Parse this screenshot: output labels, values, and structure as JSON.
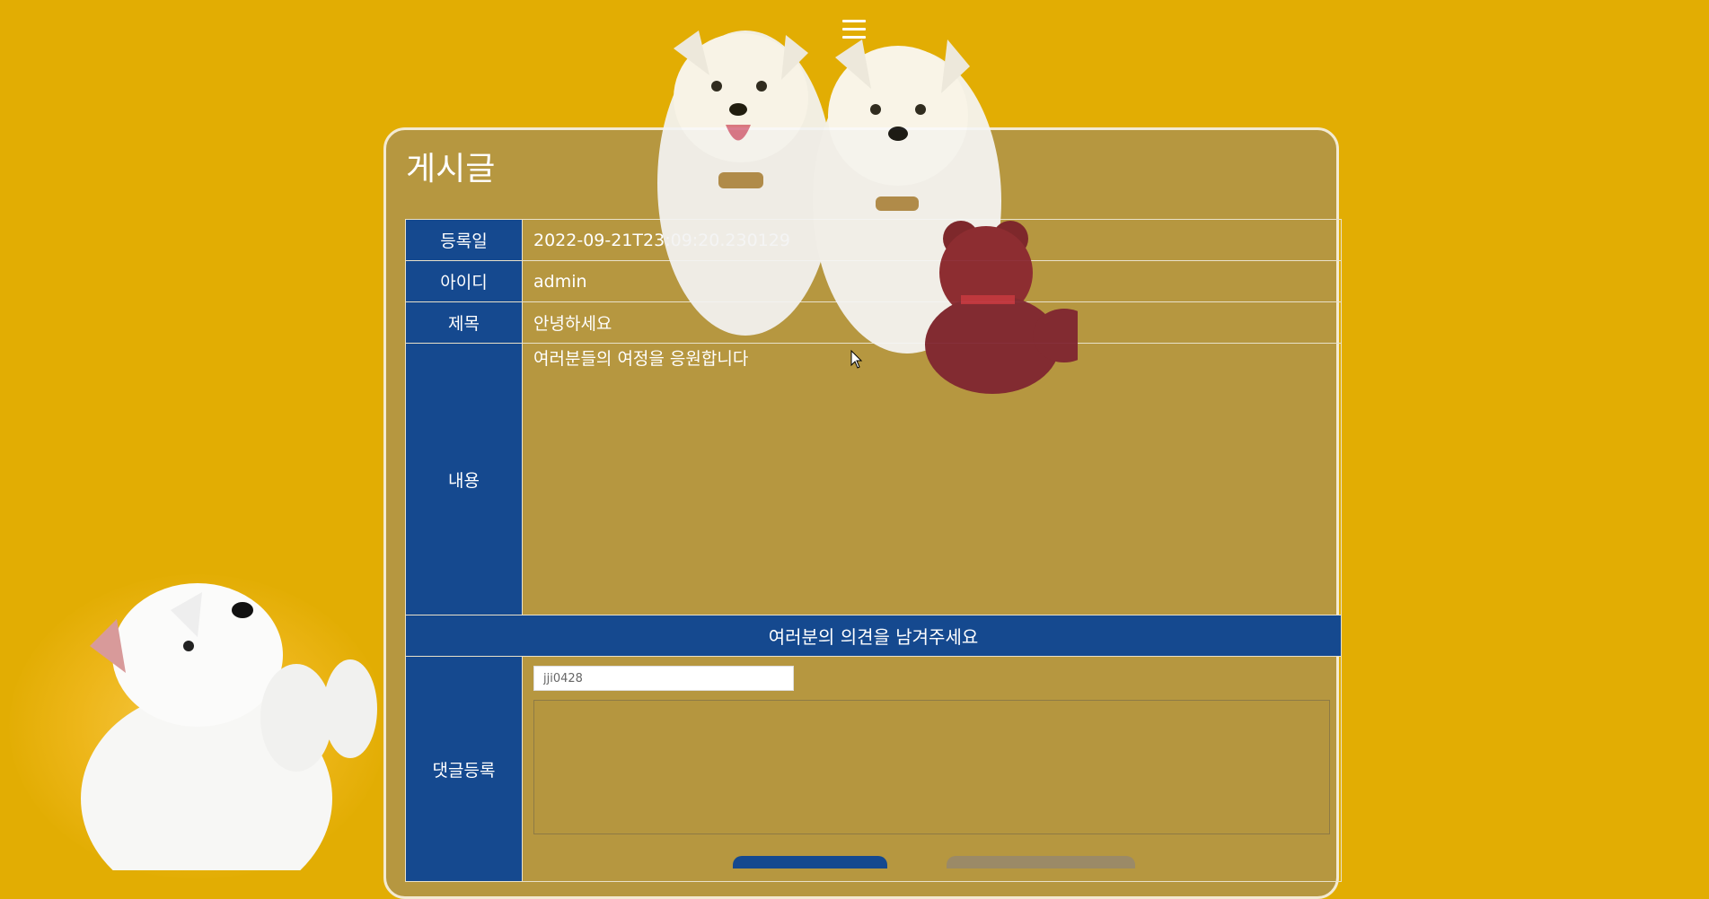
{
  "header": {
    "menu_icon": "hamburger-menu-icon"
  },
  "post": {
    "title": "게시글",
    "rows": {
      "date_label": "등록일",
      "date_value": "2022-09-21T23:09:20.230129",
      "id_label": "아이디",
      "id_value": "admin",
      "subject_label": "제목",
      "subject_value": "안녕하세요",
      "content_label": "내용",
      "content_value": "여러분들의 여정을 응원합니다"
    }
  },
  "comments": {
    "banner": "여러분의 의견을 남겨주세요",
    "label": "댓글등록",
    "writer_value": "jji0428",
    "textarea_value": ""
  },
  "colors": {
    "background": "#e2ad03",
    "label_blue": "#15498f",
    "panel": "#b5963f"
  }
}
